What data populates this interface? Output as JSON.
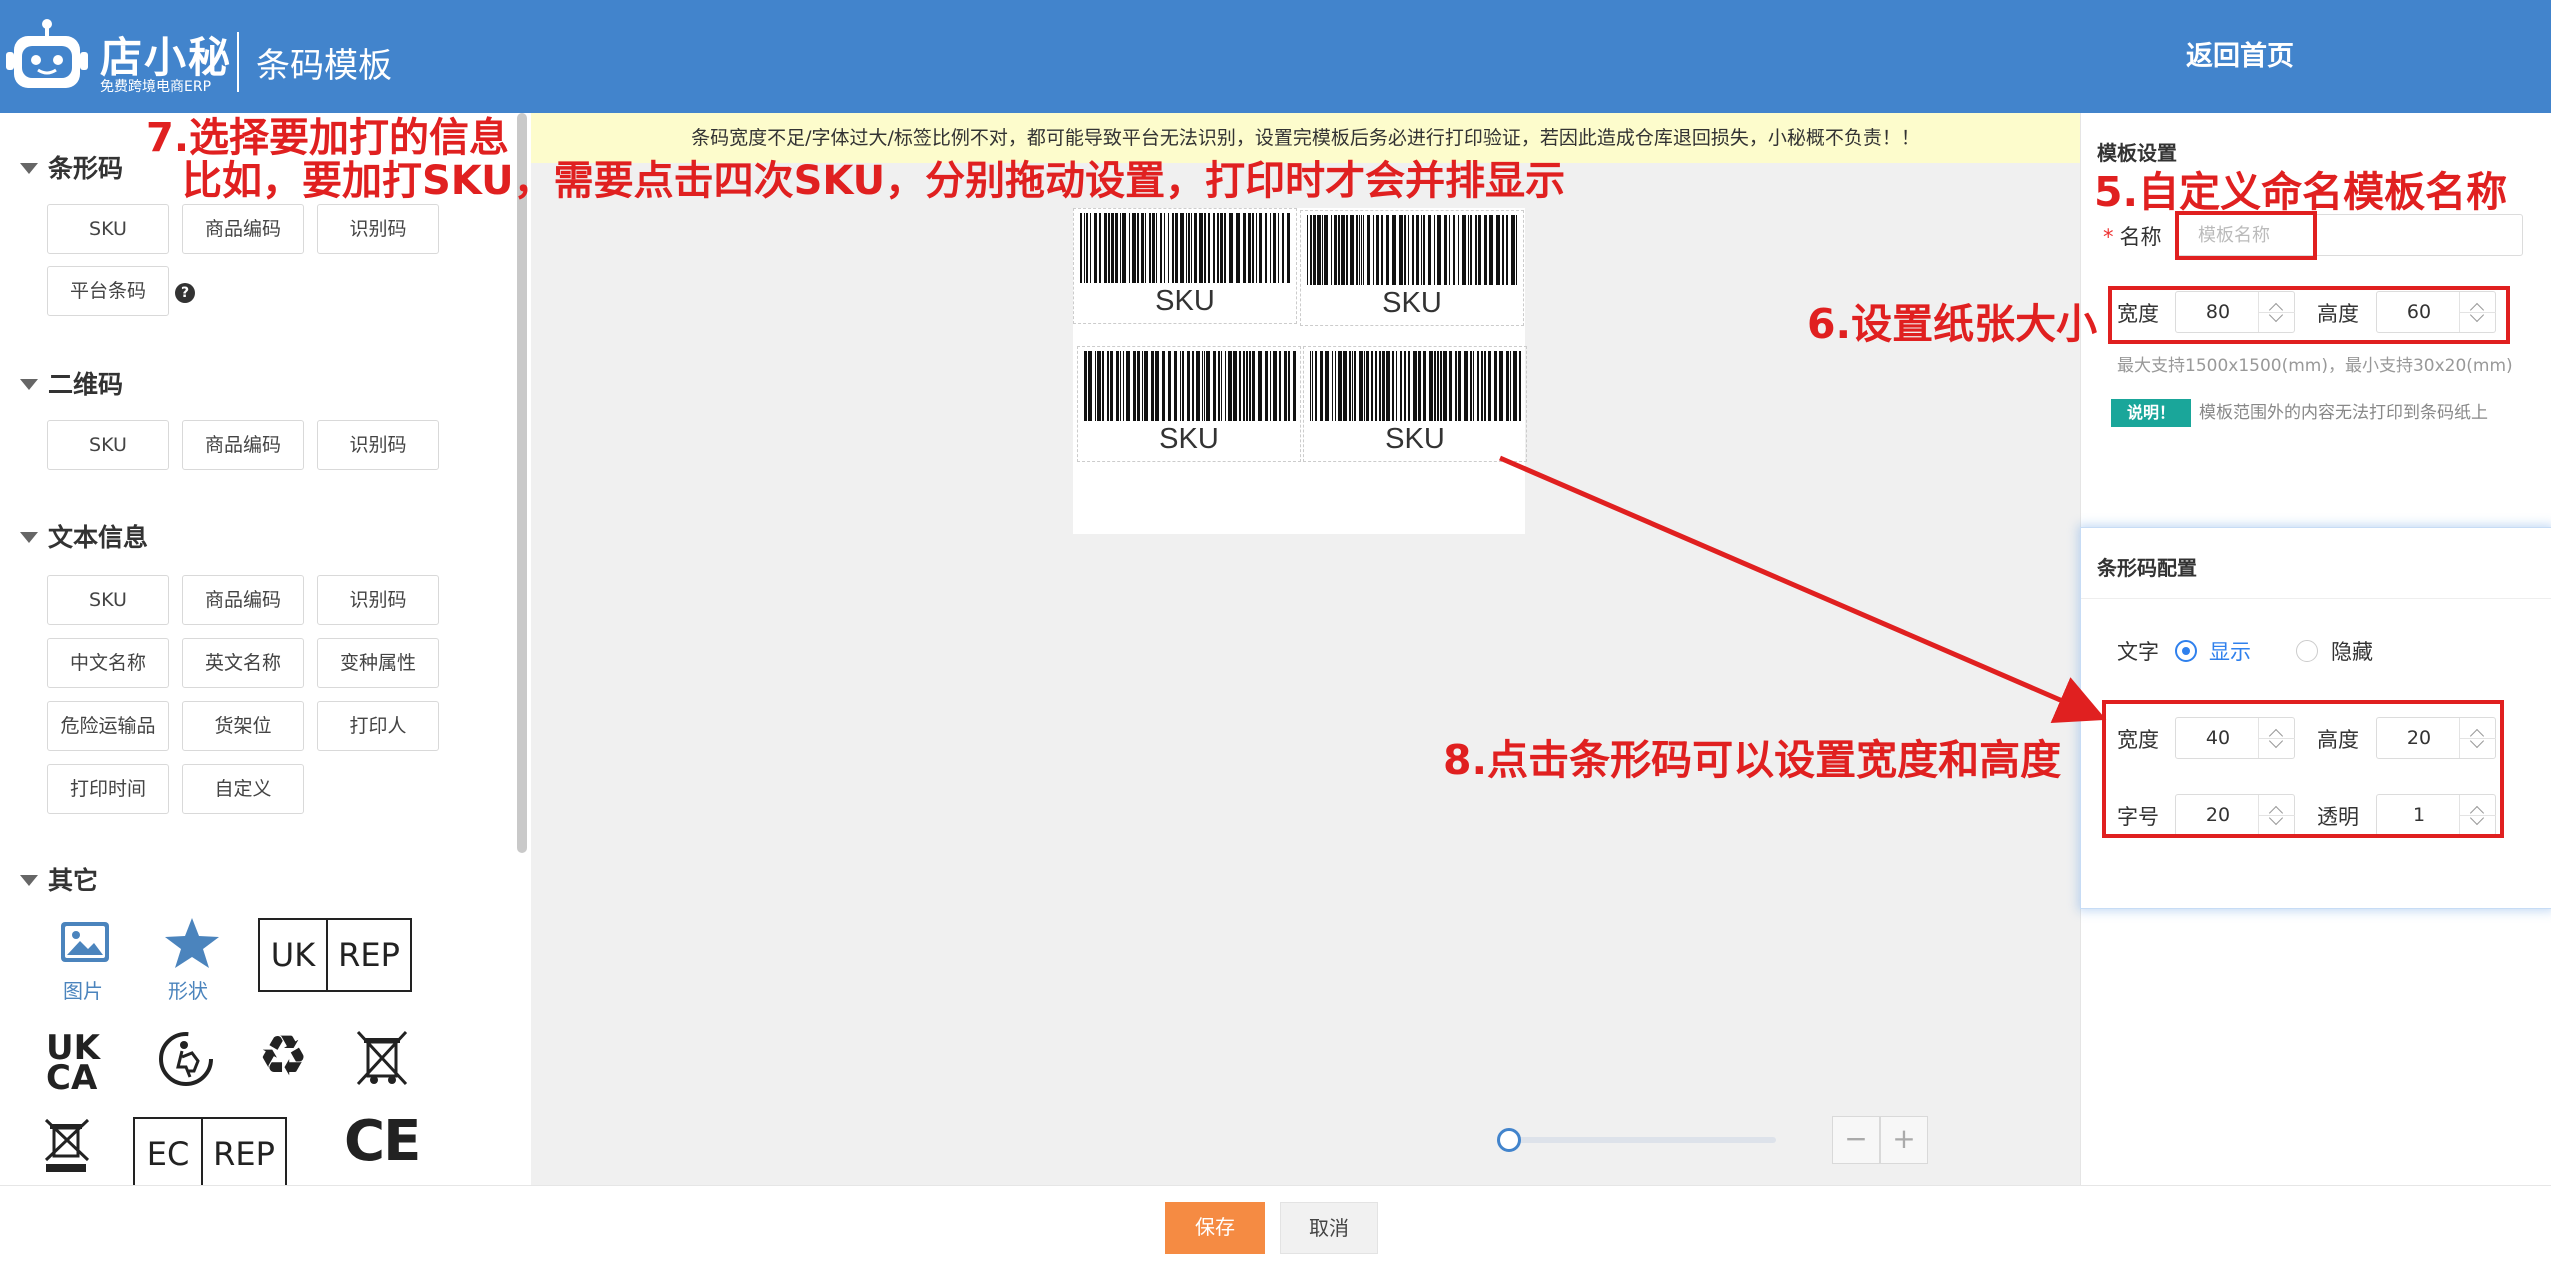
{
  "header": {
    "logo_name": "店小秘",
    "logo_tagline": "免费跨境电商ERP",
    "page_title": "条码模板",
    "back_home": "返回首页"
  },
  "left_panel": {
    "barcode": {
      "title": "条形码",
      "items": [
        "SKU",
        "商品编码",
        "识别码",
        "平台条码"
      ],
      "help": "?"
    },
    "qrcode": {
      "title": "二维码",
      "items": [
        "SKU",
        "商品编码",
        "识别码"
      ]
    },
    "text_info": {
      "title": "文本信息",
      "items": [
        "SKU",
        "商品编码",
        "识别码",
        "中文名称",
        "英文名称",
        "变种属性",
        "危险运输品",
        "货架位",
        "打印人",
        "打印时间",
        "自定义"
      ]
    },
    "other": {
      "title": "其它",
      "image_label": "图片",
      "shape_label": "形状",
      "uk_rep": [
        "UK",
        "REP"
      ],
      "ukca": [
        "UK",
        "CA"
      ],
      "ec_rep": [
        "EC",
        "REP"
      ],
      "ce": "CE"
    }
  },
  "canvas": {
    "warning": "条码宽度不足/字体过大/标签比例不对，都可能导致平台无法识别，设置完模板后务必进行打印验证，若因此造成仓库退回损失，小秘概不负责！！",
    "barcodes": [
      "SKU",
      "SKU",
      "SKU",
      "SKU"
    ],
    "zoom_minus": "−",
    "zoom_plus": "+",
    "zoom_level": 0
  },
  "right_panel": {
    "template_settings": {
      "title": "模板设置",
      "required_mark": "*",
      "name_label": "名称",
      "name_placeholder": "模板名称",
      "name_value": "",
      "width_label": "宽度",
      "width_value": "80",
      "height_label": "高度",
      "height_value": "60",
      "size_hint": "最大支持1500x1500(mm)，最小支持30x20(mm)",
      "desc_badge": "说明！",
      "desc_text": "模板范围外的内容无法打印到条码纸上"
    },
    "barcode_config": {
      "title": "条形码配置",
      "text_label": "文字",
      "show_label": "显示",
      "hide_label": "隐藏",
      "selected": "显示",
      "width_label": "宽度",
      "width_value": "40",
      "height_label": "高度",
      "height_value": "20",
      "font_label": "字号",
      "font_value": "20",
      "opacity_label": "透明",
      "opacity_value": "1"
    }
  },
  "footer": {
    "save": "保存",
    "cancel": "取消"
  },
  "annotations": {
    "note5": "5.自定义命名模板名称",
    "note6": "6.设置纸张大小",
    "note7_line1": "7.选择要加打的信息",
    "note7_line2": "比如，要加打SKU，需要点击四次SKU，分别拖动设置，打印时才会并排显示",
    "note8": "8.点击条形码可以设置宽度和高度",
    "color": "#e02020"
  },
  "colors": {
    "header_bg": "#4284cc",
    "accent": "#2f80ed",
    "save_btn": "#f58b43",
    "warning_bg": "#fdfccc",
    "badge": "#1aa69a",
    "annotation": "#e02020"
  }
}
